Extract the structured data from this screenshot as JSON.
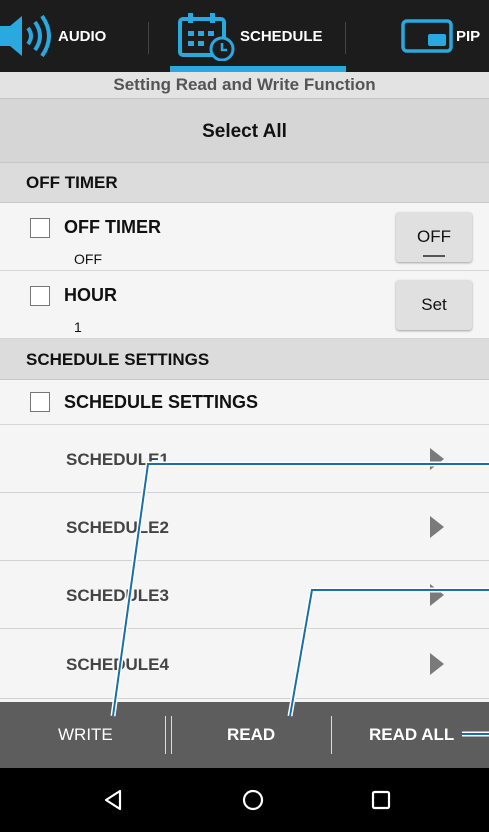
{
  "tabs": [
    {
      "label": "AUDIO",
      "icon": "speaker-icon"
    },
    {
      "label": "SCHEDULE",
      "icon": "calendar-clock-icon",
      "active": true
    },
    {
      "label": "PIP",
      "icon": "pip-icon"
    }
  ],
  "subtitle": "Setting Read and Write Function",
  "select_all": "Select All",
  "off_timer_section": {
    "title": "OFF TIMER",
    "rows": [
      {
        "label": "OFF TIMER",
        "value": "OFF",
        "button": "OFF"
      },
      {
        "label": "HOUR",
        "value": "1",
        "button": "Set"
      }
    ]
  },
  "schedule_section": {
    "title": "SCHEDULE SETTINGS",
    "checkbox_label": "SCHEDULE SETTINGS",
    "items": [
      "SCHEDULE1",
      "SCHEDULE2",
      "SCHEDULE3",
      "SCHEDULE4"
    ]
  },
  "bottom": {
    "write": "WRITE",
    "read": "READ",
    "read_all": "READ ALL"
  },
  "colors": {
    "accent": "#2aa8e0",
    "callout": "#1a6fa8",
    "topbar": "#1c1c1c",
    "bottombar": "#5d5d5d"
  }
}
